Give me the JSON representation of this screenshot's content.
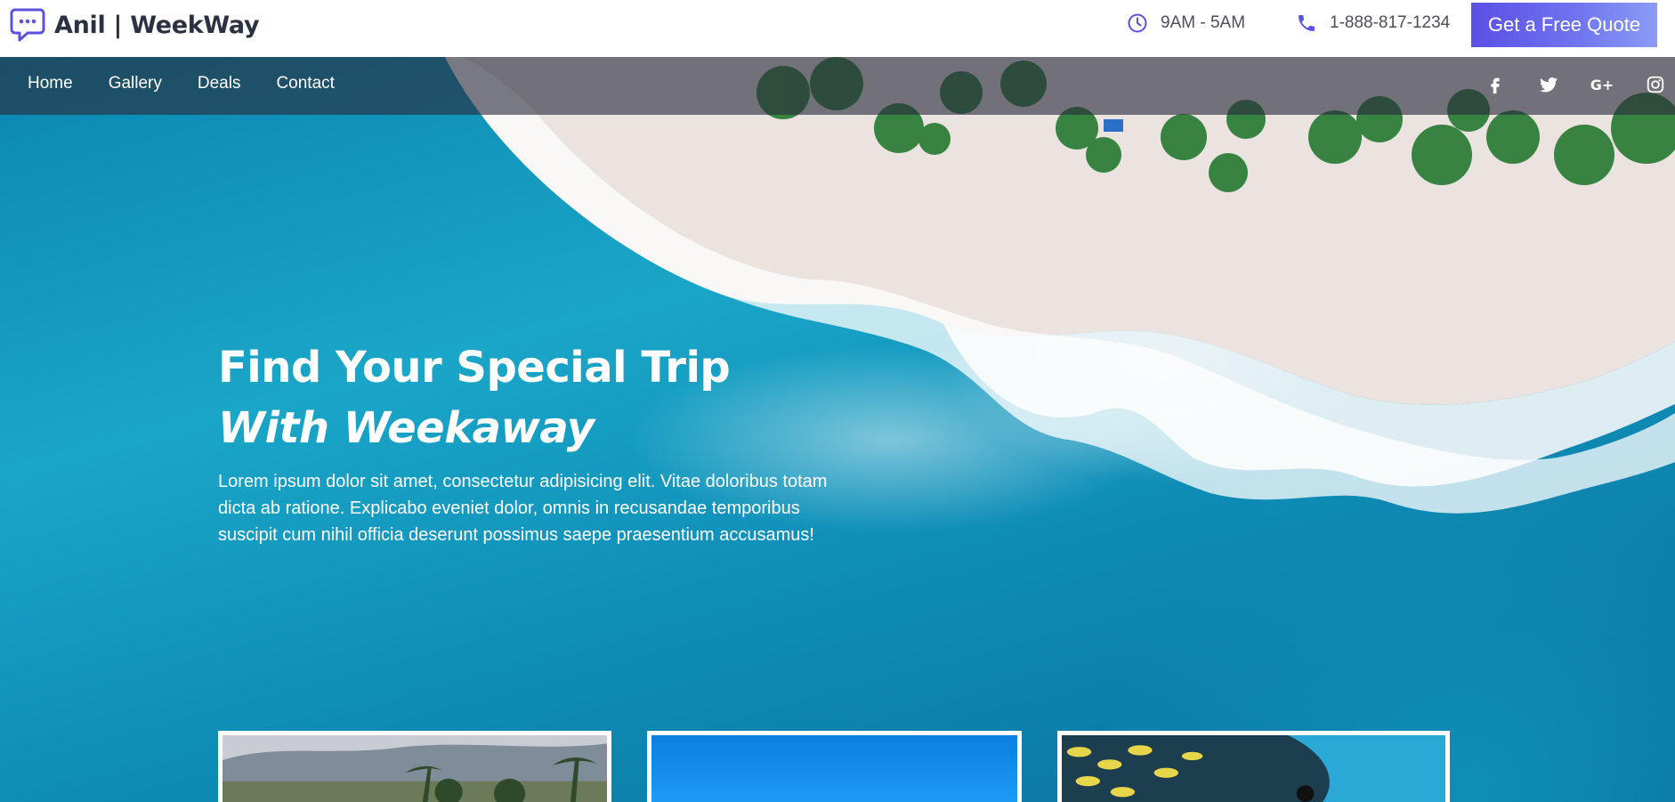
{
  "header": {
    "brand_name": "Anil | WeekWay",
    "brand_icon": "chat-bubble-icon",
    "hours": "9AM - 5AM",
    "phone": "1-888-817-1234",
    "cta_label": "Get a Free Quote",
    "accent_color": "#5b4fe6"
  },
  "nav": {
    "items": [
      {
        "label": "Home"
      },
      {
        "label": "Gallery"
      },
      {
        "label": "Deals"
      },
      {
        "label": "Contact"
      }
    ],
    "socials": [
      "facebook-icon",
      "twitter-icon",
      "google-plus-icon",
      "instagram-icon"
    ],
    "gplus_label": "G+"
  },
  "hero": {
    "title": "Find Your Special Trip",
    "subtitle": "With Weekaway",
    "description": "Lorem ipsum dolor sit amet, consectetur adipisicing elit. Vitae doloribus totam dicta ab ratione. Explicabo eveniet dolor, omnis in recusandae temporibus suscipit cum nihil officia deserunt possimus saepe praesentium accusamus!"
  },
  "cards": [
    {
      "name": "palm-beach-card"
    },
    {
      "name": "blue-sky-card"
    },
    {
      "name": "diver-fish-card"
    }
  ]
}
